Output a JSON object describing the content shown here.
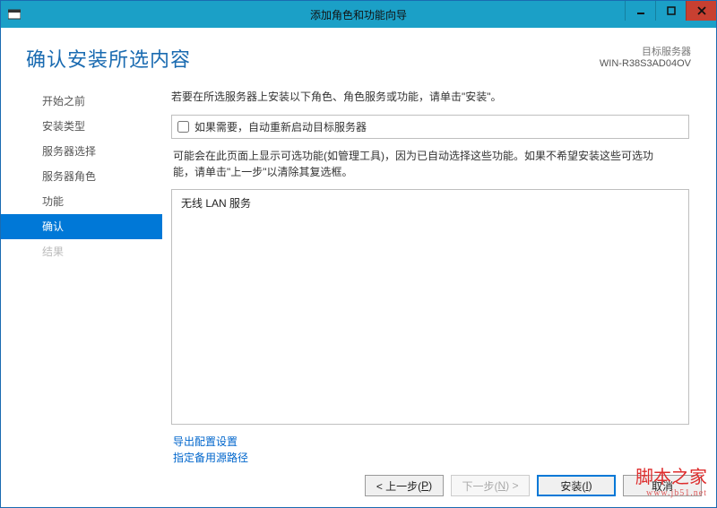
{
  "window": {
    "title": "添加角色和功能向导"
  },
  "header": {
    "title": "确认安装所选内容",
    "target_label": "目标服务器",
    "target_server": "WIN-R38S3AD04OV"
  },
  "sidebar": {
    "items": [
      {
        "label": "开始之前",
        "state": "normal"
      },
      {
        "label": "安装类型",
        "state": "normal"
      },
      {
        "label": "服务器选择",
        "state": "normal"
      },
      {
        "label": "服务器角色",
        "state": "normal"
      },
      {
        "label": "功能",
        "state": "normal"
      },
      {
        "label": "确认",
        "state": "active"
      },
      {
        "label": "结果",
        "state": "disabled"
      }
    ]
  },
  "main": {
    "description": "若要在所选服务器上安装以下角色、角色服务或功能，请单击\"安装\"。",
    "checkbox_label": "如果需要，自动重新启动目标服务器",
    "checkbox_checked": false,
    "note_line1": "可能会在此页面上显示可选功能(如管理工具)，因为已自动选择这些功能。如果不希望安装这些可选功",
    "note_line2": "能，请单击\"上一步\"以清除其复选框。",
    "features": [
      "无线 LAN 服务"
    ],
    "links": {
      "export": "导出配置设置",
      "altsource": "指定备用源路径"
    }
  },
  "footer": {
    "prev": "< 上一步(",
    "prev_u": "P",
    "prev_tail": ")",
    "next": "下一步(",
    "next_u": "N",
    "next_tail": ") >",
    "install": "安装(",
    "install_u": "I",
    "install_tail": ")",
    "cancel": "取消"
  },
  "watermark": {
    "main": "脚本之家",
    "sub": "www.jb51.net"
  }
}
